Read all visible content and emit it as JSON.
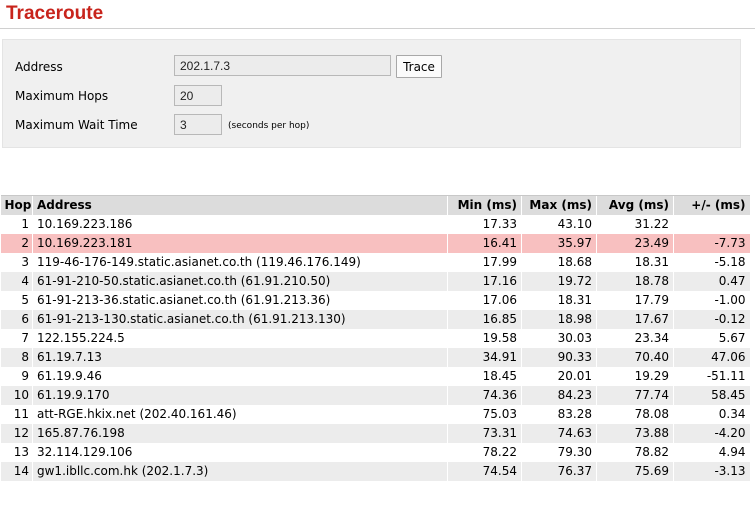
{
  "page": {
    "title": "Traceroute"
  },
  "form": {
    "address_label": "Address",
    "address_value": "202.1.7.3",
    "trace_button": "Trace",
    "max_hops_label": "Maximum Hops",
    "max_hops_value": "20",
    "max_wait_label": "Maximum Wait Time",
    "max_wait_value": "3",
    "max_wait_hint": "(seconds per hop)"
  },
  "table": {
    "headers": {
      "hop": "Hop",
      "address": "Address",
      "min": "Min (ms)",
      "max": "Max (ms)",
      "avg": "Avg (ms)",
      "delta": "+/- (ms)"
    },
    "highlight_color": "#f8c0c0",
    "rows": [
      {
        "hop": "1",
        "address": "10.169.223.186",
        "min": "17.33",
        "max": "43.10",
        "avg": "31.22",
        "delta": ""
      },
      {
        "hop": "2",
        "address": "10.169.223.181",
        "min": "16.41",
        "max": "35.97",
        "avg": "23.49",
        "delta": "-7.73",
        "highlight": true
      },
      {
        "hop": "3",
        "address": "119-46-176-149.static.asianet.co.th (119.46.176.149)",
        "min": "17.99",
        "max": "18.68",
        "avg": "18.31",
        "delta": "-5.18"
      },
      {
        "hop": "4",
        "address": "61-91-210-50.static.asianet.co.th (61.91.210.50)",
        "min": "17.16",
        "max": "19.72",
        "avg": "18.78",
        "delta": "0.47"
      },
      {
        "hop": "5",
        "address": "61-91-213-36.static.asianet.co.th (61.91.213.36)",
        "min": "17.06",
        "max": "18.31",
        "avg": "17.79",
        "delta": "-1.00"
      },
      {
        "hop": "6",
        "address": "61-91-213-130.static.asianet.co.th (61.91.213.130)",
        "min": "16.85",
        "max": "18.98",
        "avg": "17.67",
        "delta": "-0.12"
      },
      {
        "hop": "7",
        "address": "122.155.224.5",
        "min": "19.58",
        "max": "30.03",
        "avg": "23.34",
        "delta": "5.67"
      },
      {
        "hop": "8",
        "address": "61.19.7.13",
        "min": "34.91",
        "max": "90.33",
        "avg": "70.40",
        "delta": "47.06"
      },
      {
        "hop": "9",
        "address": "61.19.9.46",
        "min": "18.45",
        "max": "20.01",
        "avg": "19.29",
        "delta": "-51.11"
      },
      {
        "hop": "10",
        "address": "61.19.9.170",
        "min": "74.36",
        "max": "84.23",
        "avg": "77.74",
        "delta": "58.45"
      },
      {
        "hop": "11",
        "address": "att-RGE.hkix.net (202.40.161.46)",
        "min": "75.03",
        "max": "83.28",
        "avg": "78.08",
        "delta": "0.34"
      },
      {
        "hop": "12",
        "address": "165.87.76.198",
        "min": "73.31",
        "max": "74.63",
        "avg": "73.88",
        "delta": "-4.20"
      },
      {
        "hop": "13",
        "address": "32.114.129.106",
        "min": "78.22",
        "max": "79.30",
        "avg": "78.82",
        "delta": "4.94"
      },
      {
        "hop": "14",
        "address": "gw1.ibllc.com.hk (202.1.7.3)",
        "min": "74.54",
        "max": "76.37",
        "avg": "75.69",
        "delta": "-3.13"
      }
    ]
  }
}
